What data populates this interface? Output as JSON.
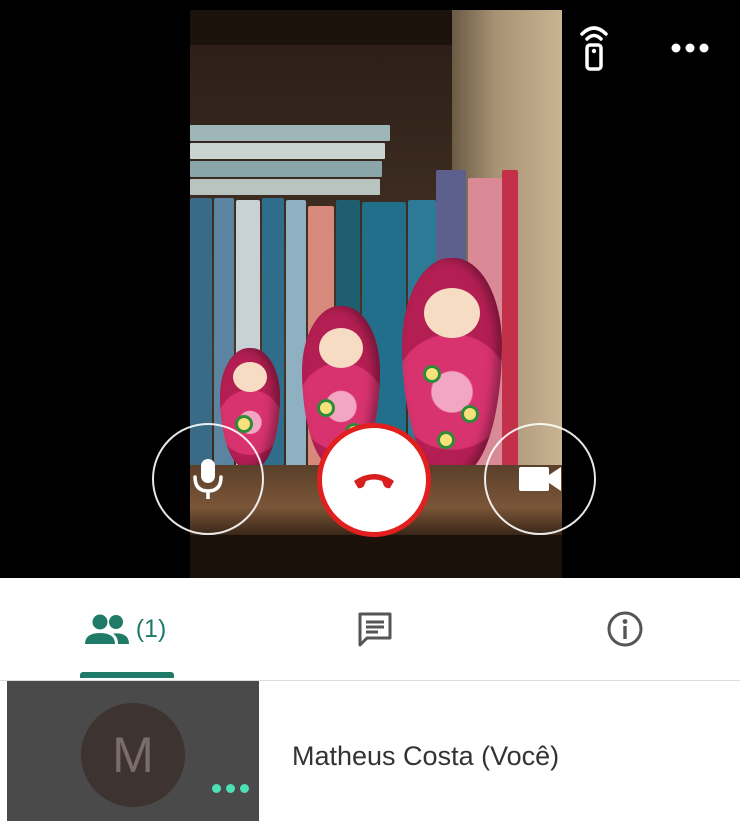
{
  "video": {
    "controls": {
      "mic": "microphone-icon",
      "end_call": "phone-hangup-icon",
      "camera": "video-camera-icon"
    },
    "top_actions": {
      "cast": "cast-remote-icon",
      "more": "more-horizontal-icon"
    }
  },
  "tabs": [
    {
      "icon": "people-icon",
      "label": "(1)",
      "active": true
    },
    {
      "icon": "chat-icon",
      "label": ""
    },
    {
      "icon": "info-icon",
      "label": ""
    }
  ],
  "participants": [
    {
      "initial": "M",
      "name": "Matheus Costa (Você)",
      "options_icon": "more-dots-icon"
    }
  ],
  "colors": {
    "accent": "#1f7a68",
    "hangup": "#e21f1f",
    "status_dots": "#4de0b3"
  }
}
